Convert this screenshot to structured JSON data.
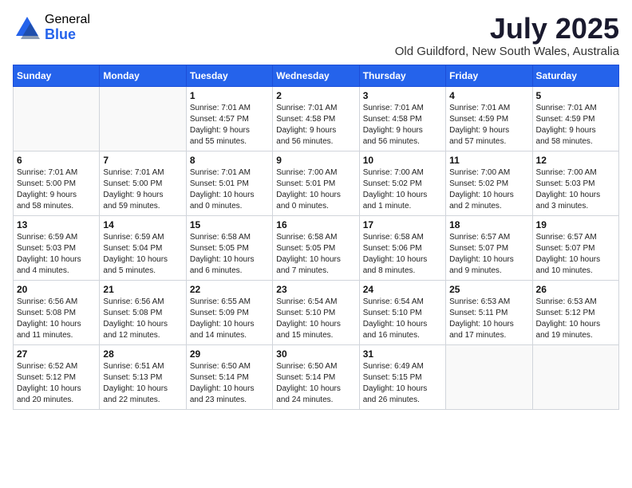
{
  "logo": {
    "general": "General",
    "blue": "Blue"
  },
  "title": "July 2025",
  "location": "Old Guildford, New South Wales, Australia",
  "weekdays": [
    "Sunday",
    "Monday",
    "Tuesday",
    "Wednesday",
    "Thursday",
    "Friday",
    "Saturday"
  ],
  "weeks": [
    [
      {
        "num": "",
        "info": ""
      },
      {
        "num": "",
        "info": ""
      },
      {
        "num": "1",
        "info": "Sunrise: 7:01 AM\nSunset: 4:57 PM\nDaylight: 9 hours\nand 55 minutes."
      },
      {
        "num": "2",
        "info": "Sunrise: 7:01 AM\nSunset: 4:58 PM\nDaylight: 9 hours\nand 56 minutes."
      },
      {
        "num": "3",
        "info": "Sunrise: 7:01 AM\nSunset: 4:58 PM\nDaylight: 9 hours\nand 56 minutes."
      },
      {
        "num": "4",
        "info": "Sunrise: 7:01 AM\nSunset: 4:59 PM\nDaylight: 9 hours\nand 57 minutes."
      },
      {
        "num": "5",
        "info": "Sunrise: 7:01 AM\nSunset: 4:59 PM\nDaylight: 9 hours\nand 58 minutes."
      }
    ],
    [
      {
        "num": "6",
        "info": "Sunrise: 7:01 AM\nSunset: 5:00 PM\nDaylight: 9 hours\nand 58 minutes."
      },
      {
        "num": "7",
        "info": "Sunrise: 7:01 AM\nSunset: 5:00 PM\nDaylight: 9 hours\nand 59 minutes."
      },
      {
        "num": "8",
        "info": "Sunrise: 7:01 AM\nSunset: 5:01 PM\nDaylight: 10 hours\nand 0 minutes."
      },
      {
        "num": "9",
        "info": "Sunrise: 7:00 AM\nSunset: 5:01 PM\nDaylight: 10 hours\nand 0 minutes."
      },
      {
        "num": "10",
        "info": "Sunrise: 7:00 AM\nSunset: 5:02 PM\nDaylight: 10 hours\nand 1 minute."
      },
      {
        "num": "11",
        "info": "Sunrise: 7:00 AM\nSunset: 5:02 PM\nDaylight: 10 hours\nand 2 minutes."
      },
      {
        "num": "12",
        "info": "Sunrise: 7:00 AM\nSunset: 5:03 PM\nDaylight: 10 hours\nand 3 minutes."
      }
    ],
    [
      {
        "num": "13",
        "info": "Sunrise: 6:59 AM\nSunset: 5:03 PM\nDaylight: 10 hours\nand 4 minutes."
      },
      {
        "num": "14",
        "info": "Sunrise: 6:59 AM\nSunset: 5:04 PM\nDaylight: 10 hours\nand 5 minutes."
      },
      {
        "num": "15",
        "info": "Sunrise: 6:58 AM\nSunset: 5:05 PM\nDaylight: 10 hours\nand 6 minutes."
      },
      {
        "num": "16",
        "info": "Sunrise: 6:58 AM\nSunset: 5:05 PM\nDaylight: 10 hours\nand 7 minutes."
      },
      {
        "num": "17",
        "info": "Sunrise: 6:58 AM\nSunset: 5:06 PM\nDaylight: 10 hours\nand 8 minutes."
      },
      {
        "num": "18",
        "info": "Sunrise: 6:57 AM\nSunset: 5:07 PM\nDaylight: 10 hours\nand 9 minutes."
      },
      {
        "num": "19",
        "info": "Sunrise: 6:57 AM\nSunset: 5:07 PM\nDaylight: 10 hours\nand 10 minutes."
      }
    ],
    [
      {
        "num": "20",
        "info": "Sunrise: 6:56 AM\nSunset: 5:08 PM\nDaylight: 10 hours\nand 11 minutes."
      },
      {
        "num": "21",
        "info": "Sunrise: 6:56 AM\nSunset: 5:08 PM\nDaylight: 10 hours\nand 12 minutes."
      },
      {
        "num": "22",
        "info": "Sunrise: 6:55 AM\nSunset: 5:09 PM\nDaylight: 10 hours\nand 14 minutes."
      },
      {
        "num": "23",
        "info": "Sunrise: 6:54 AM\nSunset: 5:10 PM\nDaylight: 10 hours\nand 15 minutes."
      },
      {
        "num": "24",
        "info": "Sunrise: 6:54 AM\nSunset: 5:10 PM\nDaylight: 10 hours\nand 16 minutes."
      },
      {
        "num": "25",
        "info": "Sunrise: 6:53 AM\nSunset: 5:11 PM\nDaylight: 10 hours\nand 17 minutes."
      },
      {
        "num": "26",
        "info": "Sunrise: 6:53 AM\nSunset: 5:12 PM\nDaylight: 10 hours\nand 19 minutes."
      }
    ],
    [
      {
        "num": "27",
        "info": "Sunrise: 6:52 AM\nSunset: 5:12 PM\nDaylight: 10 hours\nand 20 minutes."
      },
      {
        "num": "28",
        "info": "Sunrise: 6:51 AM\nSunset: 5:13 PM\nDaylight: 10 hours\nand 22 minutes."
      },
      {
        "num": "29",
        "info": "Sunrise: 6:50 AM\nSunset: 5:14 PM\nDaylight: 10 hours\nand 23 minutes."
      },
      {
        "num": "30",
        "info": "Sunrise: 6:50 AM\nSunset: 5:14 PM\nDaylight: 10 hours\nand 24 minutes."
      },
      {
        "num": "31",
        "info": "Sunrise: 6:49 AM\nSunset: 5:15 PM\nDaylight: 10 hours\nand 26 minutes."
      },
      {
        "num": "",
        "info": ""
      },
      {
        "num": "",
        "info": ""
      }
    ]
  ]
}
